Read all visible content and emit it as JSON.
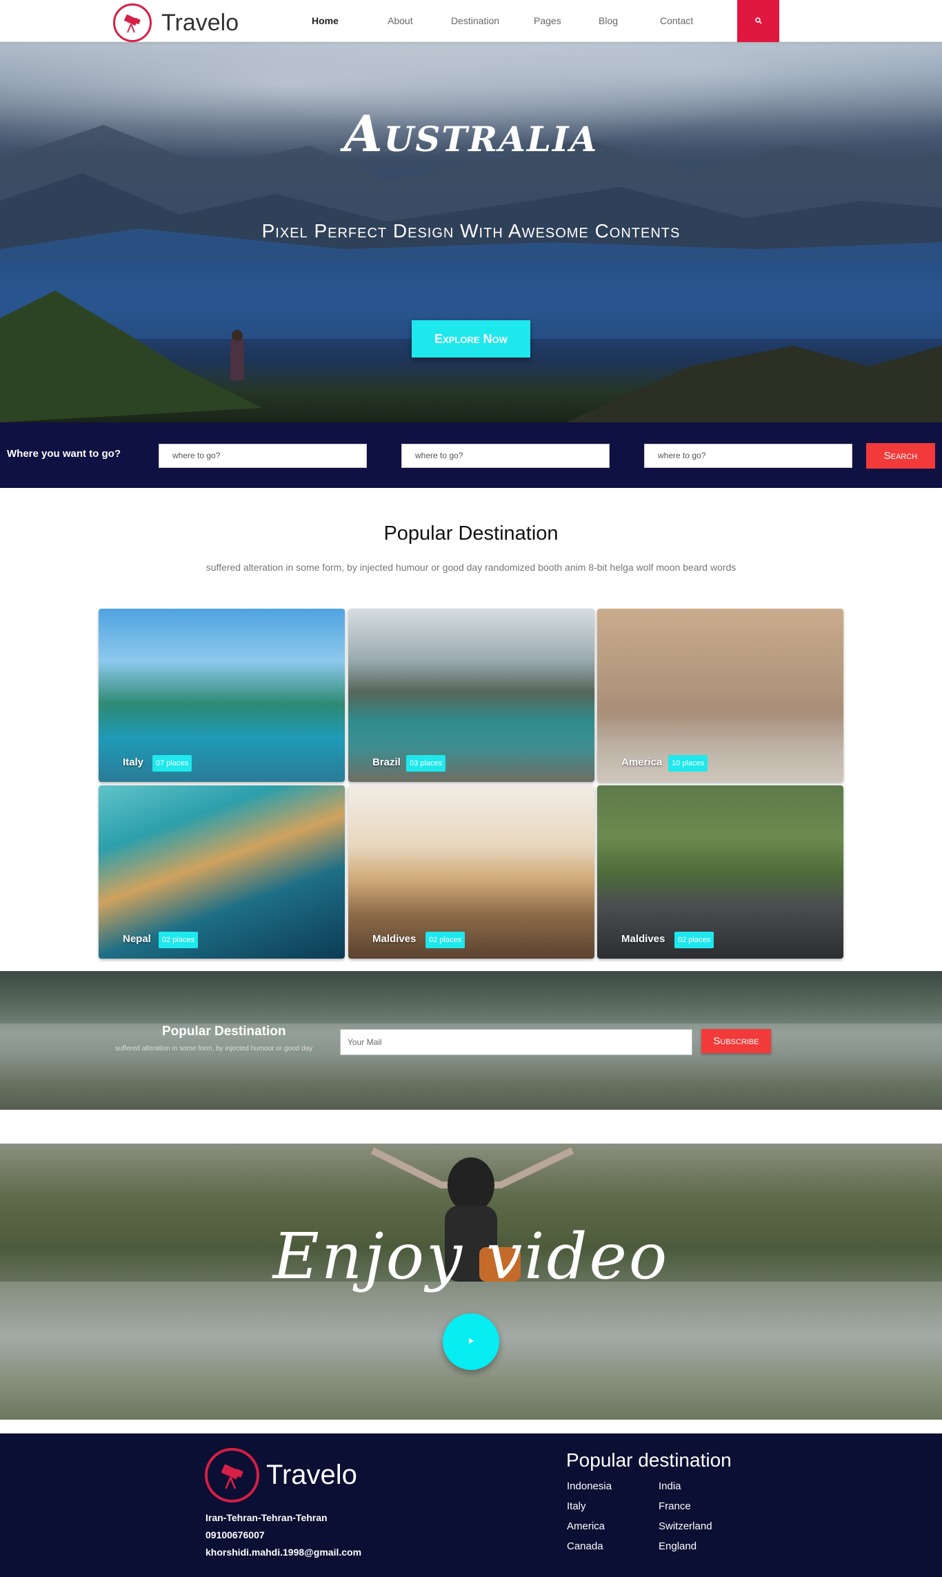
{
  "nav": {
    "brand": "Travelo",
    "items": [
      "Home",
      "About",
      "Destination",
      "Pages",
      "Blog",
      "Contact"
    ],
    "active": "Home",
    "search_icon": "search-icon",
    "accent": "#e0173e"
  },
  "hero": {
    "title": "Australia",
    "subtitle": "Pixel Perfect Design With Awesome Contents",
    "button": "Explore Now"
  },
  "search_bar": {
    "label": "Where you want to go?",
    "placeholders": [
      "where to go?",
      "where to go?",
      "where to go?"
    ],
    "button": "Search"
  },
  "popular": {
    "title": "Popular Destination",
    "description": "suffered alteration in some form, by injected humour or good day randomized booth anim 8-bit helga wolf moon beard words",
    "cards": [
      {
        "name": "Italy",
        "badge": "07 places"
      },
      {
        "name": "Brazil",
        "badge": "03 places"
      },
      {
        "name": "America",
        "badge": "10 places"
      },
      {
        "name": "Nepal",
        "badge": "02 places"
      },
      {
        "name": "Maldives",
        "badge": "02 places"
      },
      {
        "name": "Maldives",
        "badge": "02 places"
      }
    ]
  },
  "newsletter": {
    "title": "Popular Destination",
    "description": "suffered alteration in some form, by injected humour or good day",
    "placeholder": "Your Mail",
    "button": "Subscribe"
  },
  "video": {
    "title": "Enjoy video",
    "play_icon": "play-icon"
  },
  "footer": {
    "brand": "Travelo",
    "address": "Iran-Tehran-Tehran-Tehran",
    "phone": "09100676007",
    "email": "khorshidi.mahdi.1998@gmail.com",
    "dest_title": "Popular destination",
    "col1": [
      "Indonesia",
      "Italy",
      "America",
      "Canada"
    ],
    "col2": [
      "India",
      "France",
      "Switzerland",
      "England"
    ]
  }
}
